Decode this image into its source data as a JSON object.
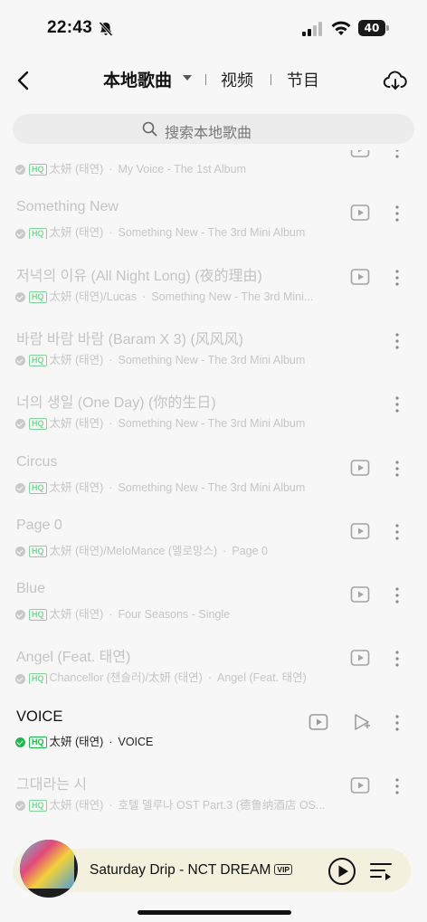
{
  "status_bar": {
    "time": "22:43",
    "battery": "40"
  },
  "header": {
    "tab_local": "本地歌曲",
    "tab_video": "视频",
    "tab_program": "节目"
  },
  "search": {
    "placeholder": "搜索本地歌曲"
  },
  "hq_badge": "HQ",
  "songs": [
    {
      "title": "",
      "artist": "太妍 (태연)",
      "album": "My Voice - The 1st Album",
      "action": "mv"
    },
    {
      "title": "Something New",
      "artist": "太妍 (태연)",
      "album": "Something New - The 3rd Mini Album",
      "action": "mv"
    },
    {
      "title": "저녁의 이유 (All Night Long) (夜的理由)",
      "artist": "太妍 (태연)/Lucas",
      "album": "Something New - The 3rd Mini...",
      "action": "mv"
    },
    {
      "title": "바람 바람 바람 (Baram X 3) (风风风)",
      "artist": "太妍 (태연)",
      "album": "Something New - The 3rd Mini Album",
      "action": "none"
    },
    {
      "title": "너의 생일 (One Day) (你的生日)",
      "artist": "太妍 (태연)",
      "album": "Something New - The 3rd Mini Album",
      "action": "none"
    },
    {
      "title": "Circus",
      "artist": "太妍 (태연)",
      "album": "Something New - The 3rd Mini Album",
      "action": "mv"
    },
    {
      "title": "Page 0",
      "artist": "太妍 (태연)/MeloMance (멜로망스)",
      "album": "Page 0",
      "action": "mv"
    },
    {
      "title": "Blue",
      "artist": "太妍 (태연)",
      "album": "Four Seasons - Single",
      "action": "mv"
    },
    {
      "title": "Angel (Feat. 태연)",
      "artist": "Chancellor (챈슬러)/太妍 (태연)",
      "album": "Angel (Feat. 태연)",
      "action": "mv"
    },
    {
      "title": "VOICE",
      "artist": "太妍 (태연)",
      "album": "VOICE",
      "action": "active"
    },
    {
      "title": "그대라는 시",
      "artist": "太妍 (태연)",
      "album": "호텔 델루나 OST Part.3 (德鲁纳酒店 OS...",
      "action": "mv"
    },
    {
      "title": "",
      "artist": "",
      "album": "",
      "action": "none"
    }
  ],
  "player": {
    "now_playing": "Saturday Drip - NCT DREAM",
    "vip": "VIP"
  },
  "colors": {
    "accent": "#22b84f",
    "player_bg": "#f3f0dd",
    "dim_text": "#c4c4c4"
  }
}
